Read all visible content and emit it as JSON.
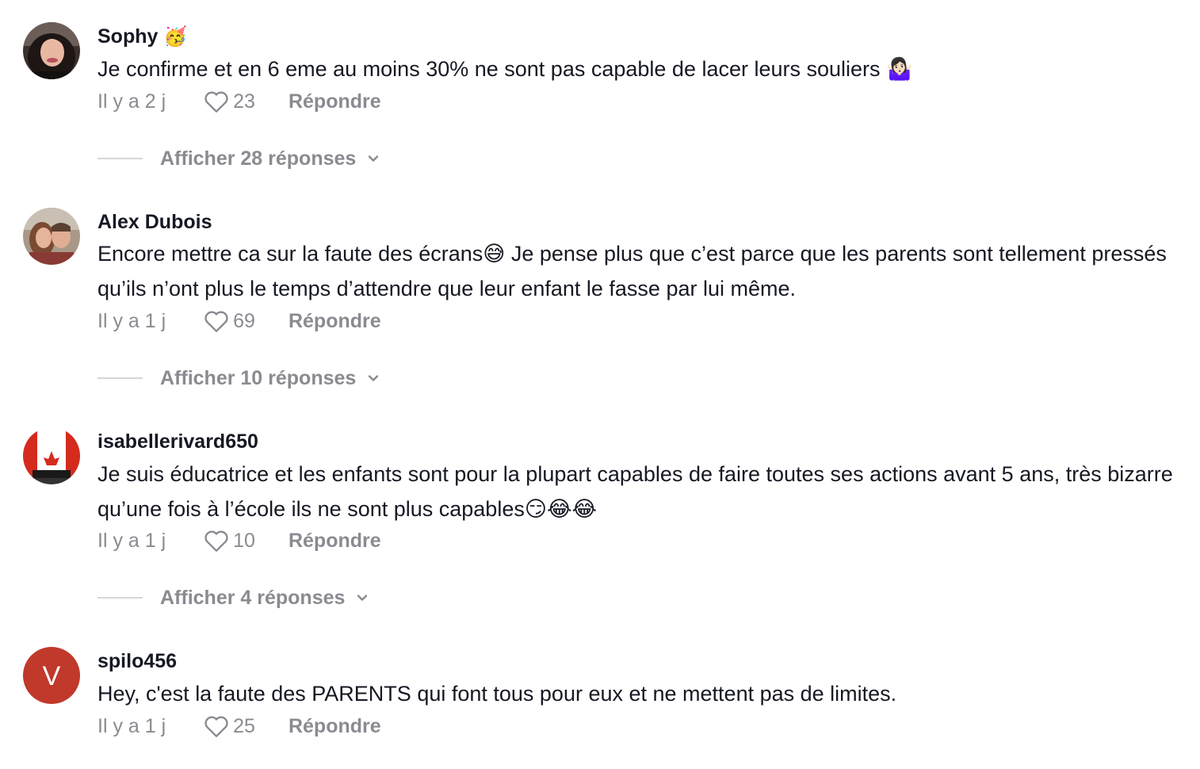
{
  "comments": [
    {
      "username": "Sophy",
      "username_emoji": "🥳",
      "text": "Je confirme et en 6 eme au moins 30% ne sont pas capable de lacer leurs souliers 🤷🏻‍♀️",
      "time": "Il y a 2 j",
      "likes": "23",
      "reply_label": "Répondre",
      "replies_label": "Afficher 28 réponses"
    },
    {
      "username": "Alex Dubois",
      "text": "Encore mettre ca sur la faute des écrans😅 Je pense plus que c’est parce que les parents sont tellement pressés qu’ils n’ont plus le temps d’attendre que leur enfant le fasse par lui même.",
      "time": "Il y a 1 j",
      "likes": "69",
      "reply_label": "Répondre",
      "replies_label": "Afficher 10 réponses"
    },
    {
      "username": "isabellerivard650",
      "text": "Je suis éducatrice et les enfants sont pour la plupart capables de faire toutes ses actions avant 5 ans, très bizarre qu’une fois à l’école ils ne sont plus capables😏😂😂",
      "time": "Il y a 1 j",
      "likes": "10",
      "reply_label": "Répondre",
      "replies_label": "Afficher 4 réponses"
    },
    {
      "username": "spilo456",
      "avatar_letter": "V",
      "avatar_color": "#c0392b",
      "text": "Hey, c'est la faute des PARENTS qui font tous pour eux et ne mettent pas de limites.",
      "time": "Il y a 1 j",
      "likes": "25",
      "reply_label": "Répondre"
    }
  ]
}
